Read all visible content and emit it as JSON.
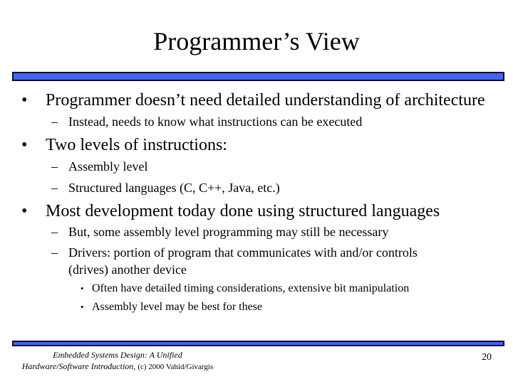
{
  "slide": {
    "title": "Programmer’s View",
    "accent_color": "#3f66f5",
    "border_color": "#0a0a2e"
  },
  "bullets": [
    {
      "marker": "•",
      "text": "Programmer doesn’t need detailed understanding of architecture",
      "children": [
        {
          "marker": "–",
          "text": "Instead, needs to know what instructions can be executed"
        }
      ]
    },
    {
      "marker": "•",
      "text": "Two levels of instructions:",
      "children": [
        {
          "marker": "–",
          "text": "Assembly level"
        },
        {
          "marker": "–",
          "text": "Structured languages (C, C++, Java, etc.)"
        }
      ]
    },
    {
      "marker": "•",
      "text": "Most development today done using structured languages",
      "children": [
        {
          "marker": "–",
          "text": "But, some assembly level programming may still be necessary"
        },
        {
          "marker": "–",
          "text_line1": "Drivers: portion of program that communicates with and/or controls",
          "text_line2": "(drives) another device",
          "children": [
            {
              "marker": "•",
              "text": "Often have detailed timing considerations, extensive bit manipulation"
            },
            {
              "marker": "•",
              "text": "Assembly level may be best for these"
            }
          ]
        }
      ]
    }
  ],
  "footer": {
    "book_title_line1": "Embedded Systems Design: A Unified",
    "book_title_line2": "Hardware/Software Introduction,",
    "copyright": "(c) 2000 Vahid/Givargis",
    "page_number": "20"
  }
}
